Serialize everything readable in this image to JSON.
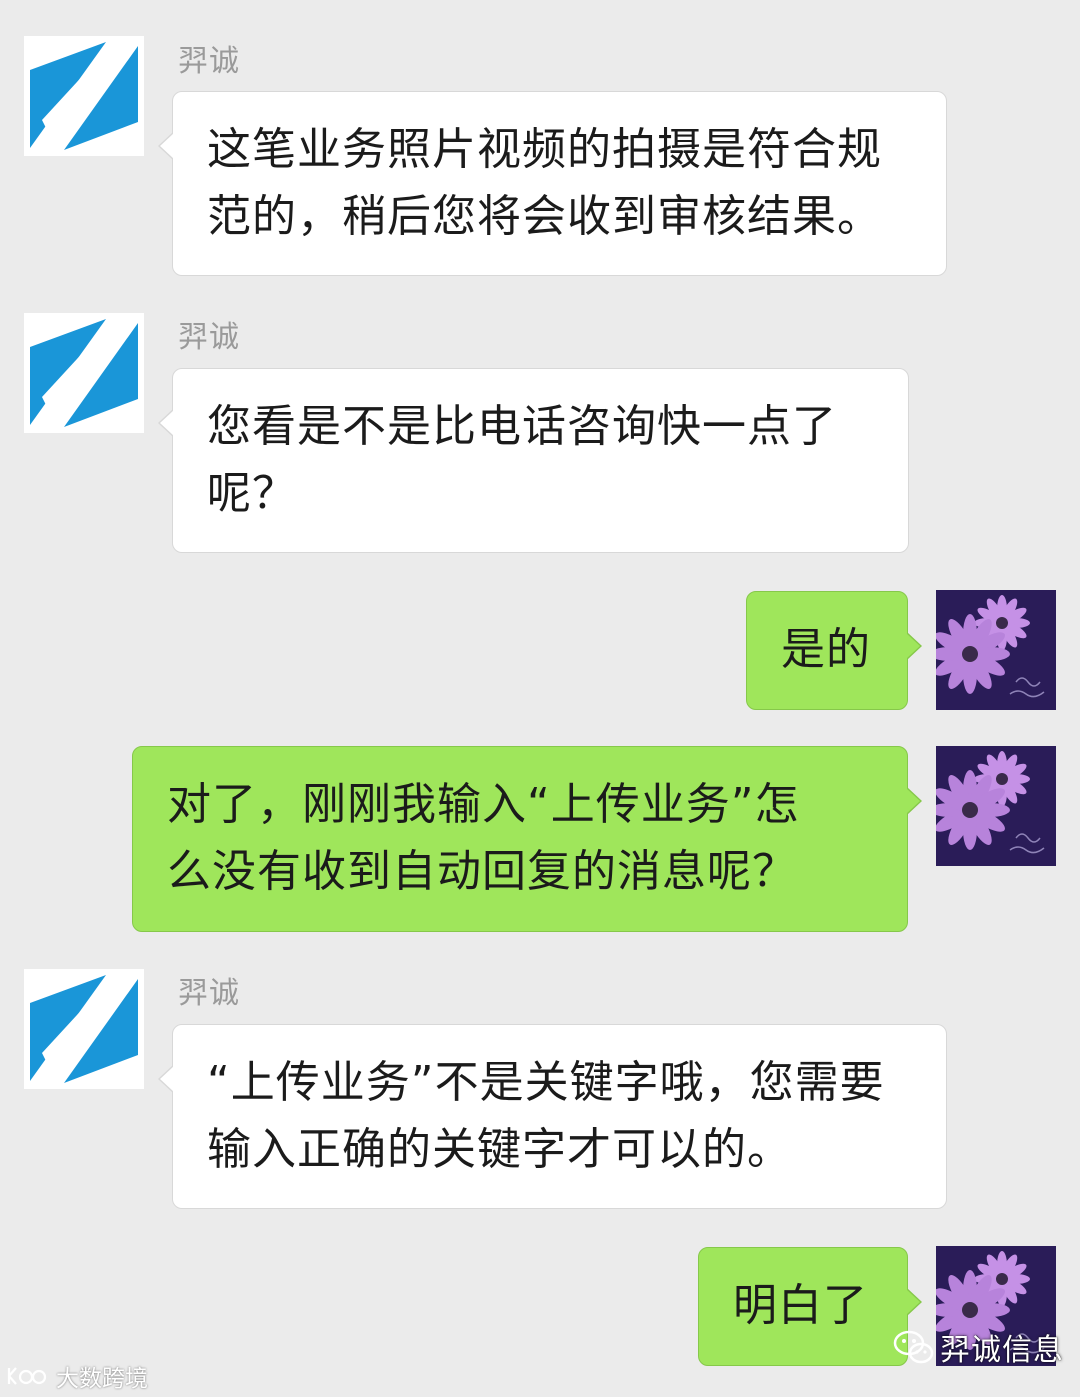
{
  "chat": {
    "contact_name": "羿诚",
    "messages": [
      {
        "direction": "in",
        "sender": "羿诚",
        "lines": [
          "这笔业务照片视频的拍摄是符合规",
          "范的，稍后您将会收到审核结果。"
        ]
      },
      {
        "direction": "in",
        "sender": "羿诚",
        "lines": [
          "您看是不是比电话咨询快一点了",
          "呢？"
        ]
      },
      {
        "direction": "out",
        "lines": [
          "是的"
        ]
      },
      {
        "direction": "out",
        "lines": [
          "对了，刚刚我输入“上传业务”怎",
          "么没有收到自动回复的消息呢？"
        ]
      },
      {
        "direction": "in",
        "sender": "羿诚",
        "lines": [
          "“上传业务”不是关键字哦，您需要",
          "输入正确的关键字才可以的。"
        ]
      },
      {
        "direction": "out",
        "lines": [
          "明白了"
        ]
      }
    ]
  },
  "avatars": {
    "contact": {
      "icon": "company-logo-icon",
      "colors": {
        "blue": "#1a96d8",
        "white": "#ffffff"
      }
    },
    "self": {
      "icon": "purple-daisy-avatar",
      "colors": {
        "background": "#2a1c58",
        "petal": "#c591e6"
      }
    }
  },
  "watermarks": {
    "wechat_account": "羿诚信息",
    "wechat_icon": "wechat-icon",
    "source_mark": "大数跨境",
    "source_icon": "source-logo-icon"
  },
  "colors": {
    "background": "#ebebeb",
    "incoming_bubble": "#ffffff",
    "outgoing_bubble": "#9fe65b",
    "name_text": "#9a9a9a",
    "message_text": "#1b1b1b"
  }
}
